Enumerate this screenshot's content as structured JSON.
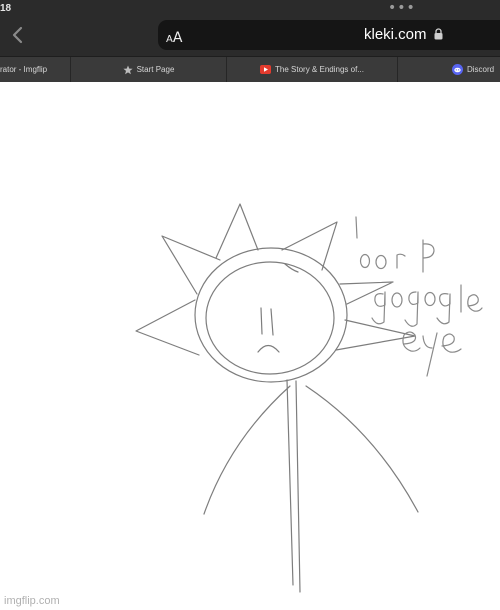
{
  "status_bar": {
    "time": "18"
  },
  "browser": {
    "reader_small": "A",
    "reader_large": "A",
    "url": "kleki.com"
  },
  "tabs": [
    {
      "label": "rator - Imgflip"
    },
    {
      "label": "Start Page",
      "icon": "star-icon"
    },
    {
      "label": "The Story & Endings of...",
      "icon": "youtube-icon"
    },
    {
      "label": "Discord",
      "icon": "discord-icon"
    }
  ],
  "drawing": {
    "handwriting_lines": [
      "I",
      "oorp",
      "google",
      "eye"
    ]
  },
  "watermark": "imgflip.com"
}
